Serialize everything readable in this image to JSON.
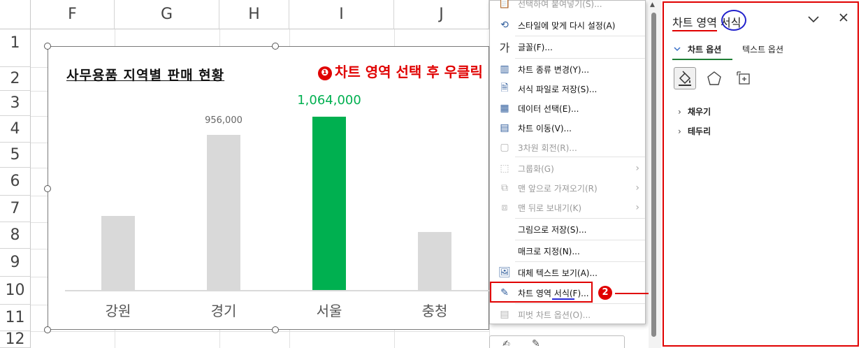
{
  "sheet": {
    "columns": [
      "F",
      "G",
      "H",
      "I",
      "J"
    ],
    "rows": [
      "1",
      "2",
      "3",
      "4",
      "5",
      "6",
      "7",
      "8",
      "9",
      "10",
      "11",
      "12"
    ]
  },
  "chart": {
    "title": "사무용품 지역별 판매 현황",
    "annotation_marker": "❶",
    "annotation": "차트 영역 선택 후 우클릭"
  },
  "chart_data": {
    "type": "bar",
    "title": "사무용품 지역별 판매 현황",
    "categories": [
      "강원",
      "경기",
      "서울",
      "충청"
    ],
    "values": [
      460000,
      956000,
      1064000,
      360000
    ],
    "data_labels": [
      "",
      "956,000",
      "1,064,000",
      ""
    ],
    "ylim": [
      0,
      1150000
    ],
    "highlight_category": "서울",
    "colors": {
      "default": "#d9d9d9",
      "highlight": "#00b050"
    },
    "grid": false,
    "legend": "none"
  },
  "context_menu": {
    "items": [
      {
        "label": "선택하여 붙여넣기(S)...",
        "icon": "paste-special-icon",
        "disabled": true
      },
      {
        "label": "스타일에 맞게 다시 설정(A)",
        "icon": "reset-style-icon",
        "disabled": false
      },
      {
        "label": "글꼴(F)...",
        "icon": "font-icon",
        "glyph": "가",
        "disabled": false
      },
      {
        "label": "차트 종류 변경(Y)...",
        "icon": "chart-type-icon",
        "disabled": false
      },
      {
        "label": "서식 파일로 저장(S)...",
        "icon": "save-template-icon",
        "disabled": false
      },
      {
        "label": "데이터 선택(E)...",
        "icon": "select-data-icon",
        "disabled": false
      },
      {
        "label": "차트 이동(V)...",
        "icon": "move-chart-icon",
        "disabled": false
      },
      {
        "label": "3차원 회전(R)...",
        "icon": "3d-rotation-icon",
        "disabled": true
      },
      {
        "label": "그룹화(G)",
        "icon": "group-icon",
        "disabled": true,
        "submenu": true
      },
      {
        "label": "맨 앞으로 가져오기(R)",
        "icon": "bring-front-icon",
        "disabled": true,
        "submenu": true
      },
      {
        "label": "맨 뒤로 보내기(K)",
        "icon": "send-back-icon",
        "disabled": true,
        "submenu": true
      },
      {
        "label": "그림으로 저장(S)...",
        "icon": "",
        "disabled": false
      },
      {
        "label": "매크로 지정(N)...",
        "icon": "",
        "disabled": false
      },
      {
        "label": "대체 텍스트 보기(A)...",
        "icon": "alt-text-icon",
        "disabled": false
      },
      {
        "label": "차트 영역 서식(F)...",
        "icon": "format-chart-area-icon",
        "disabled": false
      },
      {
        "label": "피벗 차트 옵션(O)...",
        "icon": "pivot-options-icon",
        "disabled": true
      }
    ],
    "step2_marker": "2"
  },
  "pane": {
    "title": "차트 영역 서식",
    "tabs": [
      "차트 옵션",
      "텍스트 옵션"
    ],
    "icons": [
      "fill-line-icon",
      "effects-icon",
      "size-properties-icon"
    ],
    "sections": [
      "채우기",
      "테두리"
    ]
  },
  "colors": {
    "accent_red": "#e00000",
    "accent_blue": "#2222cc",
    "highlight_bar": "#00b050",
    "tab_underline": "#1e7e34"
  }
}
